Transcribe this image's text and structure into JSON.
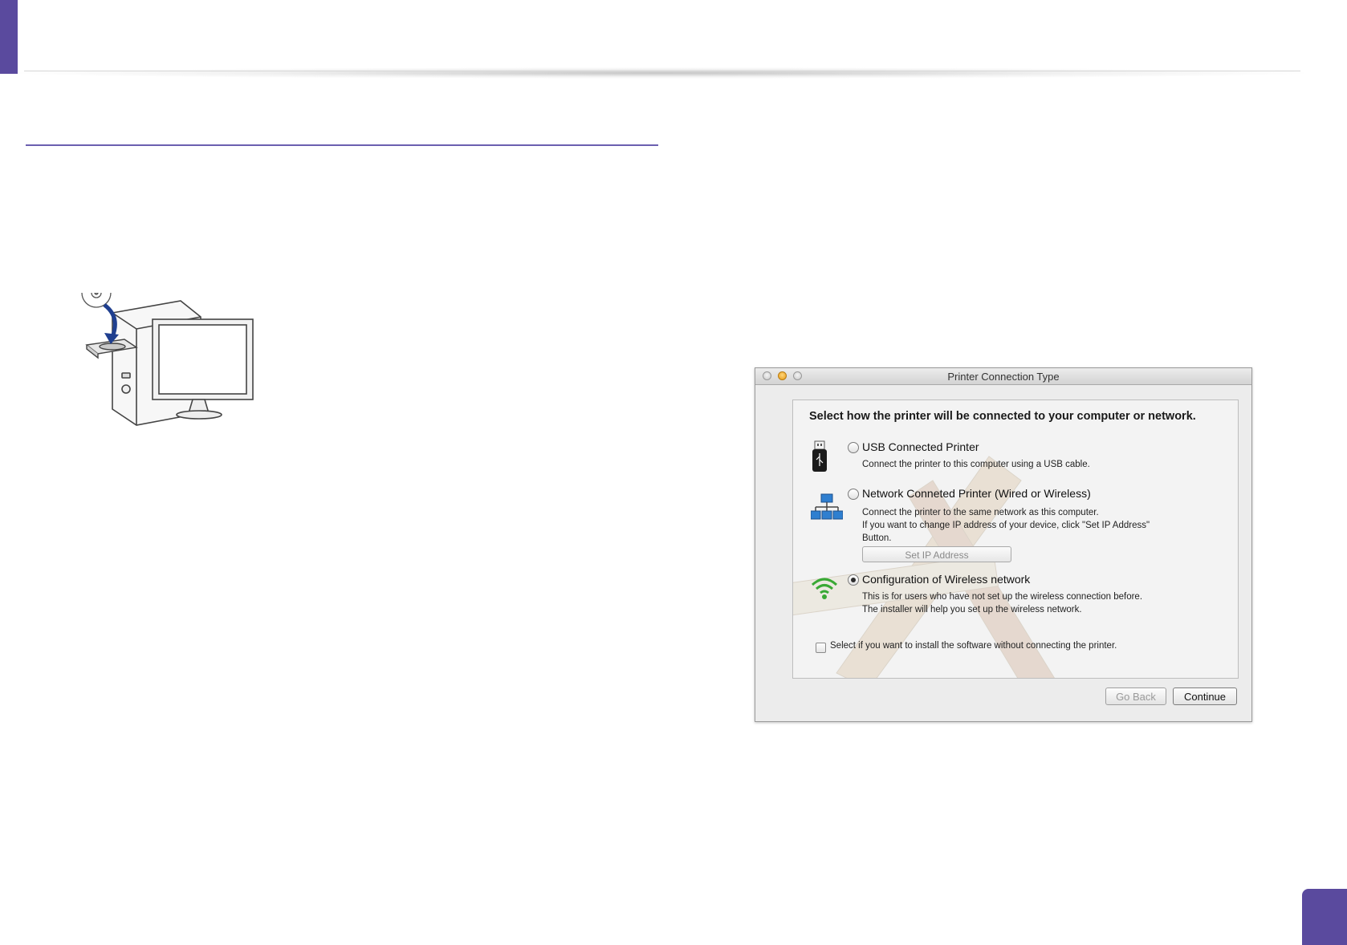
{
  "dialog": {
    "title": "Printer Connection Type",
    "heading": "Select how the printer will be connected to your computer or network.",
    "options": [
      {
        "label": "USB Connected Printer",
        "description": [
          "Connect the printer to this computer using a USB cable."
        ],
        "icon": "usb-icon",
        "selected": false
      },
      {
        "label": "Network Conneted Printer (Wired or Wireless)",
        "description": [
          "Connect the printer to the same network as this computer.",
          "If you want to change IP address of your device, click \"Set IP Address\"",
          "Button."
        ],
        "icon": "network-icon",
        "selected": false
      },
      {
        "label": "Configuration of Wireless network",
        "description": [
          "This is for users who have not set up the wireless connection before.",
          "The installer will help you set up the wireless network."
        ],
        "icon": "wifi-icon",
        "selected": true
      }
    ],
    "set_ip_button": "Set IP Address",
    "checkbox_label": "Select if you want to install the software without connecting the printer.",
    "go_back_button": "Go Back",
    "continue_button": "Continue"
  },
  "colors": {
    "accent": "#5a4a9e",
    "rule": "#6b5fb0"
  }
}
